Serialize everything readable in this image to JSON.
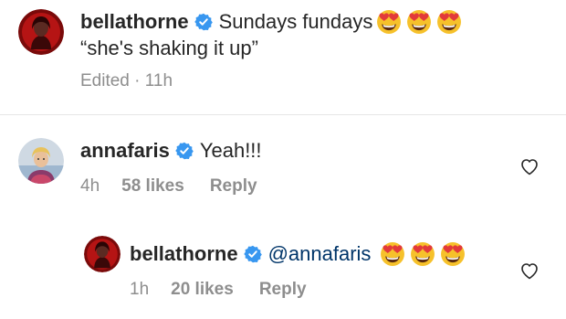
{
  "caption": {
    "username": "bellathorne",
    "text": "Sundays fundays",
    "emoji": [
      "heart-eyes",
      "heart-eyes",
      "heart-eyes"
    ],
    "line2": "“she's shaking it up”",
    "meta": "Edited · 11h"
  },
  "comments": [
    {
      "username": "annafaris",
      "text": "Yeah!!!",
      "time": "4h",
      "likes": "58 likes",
      "reply": "Reply"
    },
    {
      "username": "bellathorne",
      "mention": "@annafaris",
      "emoji": [
        "heart-eyes",
        "heart-eyes",
        "heart-eyes"
      ],
      "time": "1h",
      "likes": "20 likes",
      "reply": "Reply"
    }
  ],
  "icons": {
    "verified": "verified-badge-icon",
    "like": "heart-outline-icon",
    "emoji": "heart-eyes-emoji-icon"
  },
  "colors": {
    "verified_blue": "#3897f0",
    "text": "#262626",
    "meta_gray": "#8e8e8e",
    "mention": "#003569"
  }
}
